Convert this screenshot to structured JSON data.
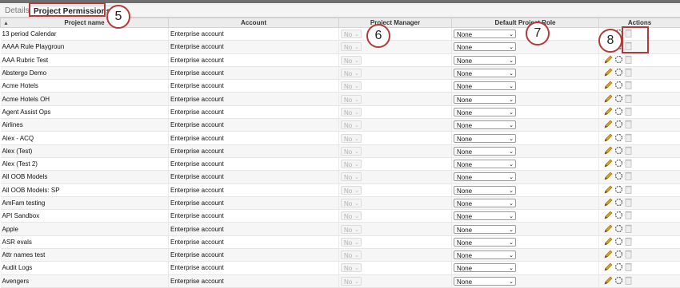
{
  "tabs": {
    "details": "Details",
    "permissions": "Project Permissions"
  },
  "columns": {
    "name": "Project name",
    "account": "Account",
    "manager": "Project Manager",
    "role": "Default Project Role",
    "actions": "Actions"
  },
  "sort_icon": "sort-ascending-icon",
  "rows": [
    {
      "name": "13 period Calendar",
      "account": "Enterprise account",
      "manager": "No",
      "role": "None"
    },
    {
      "name": "AAAA Rule Playgroun",
      "account": "Enterprise account",
      "manager": "No",
      "role": "None"
    },
    {
      "name": "AAA Rubric Test",
      "account": "Enterprise account",
      "manager": "No",
      "role": "None"
    },
    {
      "name": "Abstergo Demo",
      "account": "Enterprise account",
      "manager": "No",
      "role": "None"
    },
    {
      "name": "Acme Hotels",
      "account": "Enterprise account",
      "manager": "No",
      "role": "None"
    },
    {
      "name": "Acme Hotels OH",
      "account": "Enterprise account",
      "manager": "No",
      "role": "None"
    },
    {
      "name": "Agent Assist Ops",
      "account": "Enterprise account",
      "manager": "No",
      "role": "None"
    },
    {
      "name": "Airlines",
      "account": "Enterprise account",
      "manager": "No",
      "role": "None"
    },
    {
      "name": "Alex - ACQ",
      "account": "Enterprise account",
      "manager": "No",
      "role": "None"
    },
    {
      "name": "Alex (Test)",
      "account": "Enterprise account",
      "manager": "No",
      "role": "None"
    },
    {
      "name": "Alex (Test 2)",
      "account": "Enterprise account",
      "manager": "No",
      "role": "None"
    },
    {
      "name": "All OOB Models",
      "account": "Enterprise account",
      "manager": "No",
      "role": "None"
    },
    {
      "name": "All OOB Models: SP",
      "account": "Enterprise account",
      "manager": "No",
      "role": "None"
    },
    {
      "name": "AmFam testing",
      "account": "Enterprise account",
      "manager": "No",
      "role": "None"
    },
    {
      "name": "API Sandbox",
      "account": "Enterprise account",
      "manager": "No",
      "role": "None"
    },
    {
      "name": "Apple",
      "account": "Enterprise account",
      "manager": "No",
      "role": "None"
    },
    {
      "name": "ASR evals",
      "account": "Enterprise account",
      "manager": "No",
      "role": "None"
    },
    {
      "name": "Attr names test",
      "account": "Enterprise account",
      "manager": "No",
      "role": "None"
    },
    {
      "name": "Audit Logs",
      "account": "Enterprise account",
      "manager": "No",
      "role": "None"
    },
    {
      "name": "Avengers",
      "account": "Enterprise account",
      "manager": "No",
      "role": "None"
    }
  ],
  "callouts": {
    "tabs": "5",
    "manager": "6",
    "role": "7",
    "actions": "8"
  },
  "colors": {
    "callout": "#b23a3a",
    "pencil": "#d9a21b",
    "trash": "#bdbdbd"
  }
}
